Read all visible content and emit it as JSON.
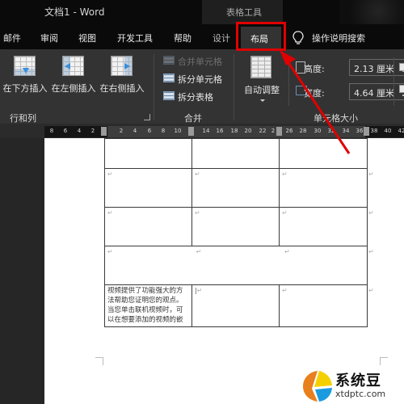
{
  "titlebar": {
    "title": "文档1  -  Word",
    "context_group": "表格工具"
  },
  "tabs": {
    "items": [
      {
        "label": "邮件"
      },
      {
        "label": "审阅"
      },
      {
        "label": "视图"
      },
      {
        "label": "开发工具"
      },
      {
        "label": "帮助"
      },
      {
        "label": "设计"
      }
    ],
    "active": "布局",
    "tell_me": "操作说明搜索"
  },
  "ribbon": {
    "rows_cols": {
      "insert_below": "在下方插入",
      "insert_left": "在左侧插入",
      "insert_right": "在右侧插入",
      "group_label": "行和列"
    },
    "merge": {
      "merge_cells": "合并单元格",
      "split_cells": "拆分单元格",
      "split_table": "拆分表格",
      "group_label": "合并"
    },
    "autofit": {
      "label": "自动调整"
    },
    "cell_size": {
      "height_label": "高度:",
      "height_value": "2.13 厘米",
      "width_label": "宽度:",
      "width_value": "4.64 厘米",
      "group_label": "单元格大小"
    }
  },
  "ruler": {
    "left_ticks": [
      "8",
      "6",
      "4",
      "2"
    ],
    "right_ticks": [
      "2",
      "4",
      "6",
      "8",
      "10",
      "14",
      "16",
      "18",
      "20",
      "22",
      "2",
      "26",
      "28",
      "30",
      "32",
      "34",
      "36",
      "38",
      "40",
      "42"
    ]
  },
  "document": {
    "cell_text": "视频提供了功能强大的方法帮助您证明您的观点。当您单击联机视频时，可以在想要添加的视频的嵌",
    "paragraph_mark": "↵"
  },
  "watermark": {
    "brand": "系统豆",
    "url": "xtdptc.com",
    "colors": {
      "orange": "#e8801e",
      "yellow": "#f5d000",
      "blue": "#1a9be0"
    }
  },
  "annotation": {
    "color": "#e00000"
  }
}
